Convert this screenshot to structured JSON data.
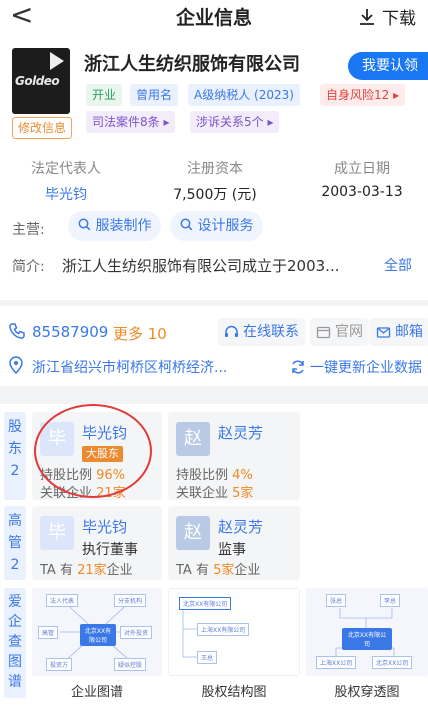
{
  "header": {
    "back_glyph": "<",
    "title": "企业信息",
    "download_label": "下载"
  },
  "company": {
    "logo_text": "Goldeo",
    "name": "浙江人生纺织服饰有限公司",
    "claim_label": "我要认领",
    "tags": [
      "开业",
      "曾用名",
      "A级纳税人 (2023)",
      "自身风险12 ▸",
      "司法案件8条 ▸",
      "涉诉关系5个 ▸"
    ],
    "edit_label": "修改信息"
  },
  "stats": {
    "legal_rep_label": "法定代表人",
    "legal_rep": "毕光钧",
    "capital_label": "注册资本",
    "capital": "7,500万 (元)",
    "founded_label": "成立日期",
    "founded": "2003-03-13"
  },
  "business": {
    "label": "主营:",
    "chips": [
      "服装制作",
      "设计服务"
    ]
  },
  "intro": {
    "label": "简介:",
    "text": "浙江人生纺织服饰有限公司成立于2003...",
    "all_label": "全部"
  },
  "contact": {
    "phone": "85587909",
    "more": "更多 10",
    "actions": [
      "在线联系",
      "官网",
      "邮箱"
    ],
    "address": "浙江省绍兴市柯桥区柯桥经济...",
    "update_label": "一键更新企业数据"
  },
  "shareholders": {
    "side_label": [
      "股",
      "东",
      "2"
    ],
    "items": [
      {
        "avatar": "毕",
        "name": "毕光钧",
        "badge": "大股东",
        "ratio_label": "持股比例",
        "ratio": "96%",
        "rel_label": "关联企业",
        "rel": "21家"
      },
      {
        "avatar": "赵",
        "name": "赵灵芳",
        "ratio_label": "持股比例",
        "ratio": "4%",
        "rel_label": "关联企业",
        "rel": "5家"
      }
    ]
  },
  "executives": {
    "side_label": [
      "高",
      "管",
      "2"
    ],
    "items": [
      {
        "avatar": "毕",
        "name": "毕光钧",
        "role": "执行董事",
        "pre": "TA 有",
        "count": "21家",
        "post": "企业"
      },
      {
        "avatar": "赵",
        "name": "赵灵芳",
        "role": "监事",
        "pre": "TA 有",
        "count": "5家",
        "post": "企业"
      }
    ]
  },
  "graphs": {
    "side_label": [
      "爱",
      "企",
      "查",
      "图",
      "谱"
    ],
    "items": [
      "企业图谱",
      "股权结构图",
      "股权穿透图"
    ],
    "thumb1": {
      "hub": "北京XX有限公司",
      "nodes": [
        "法人代表",
        "分支机构",
        "高管",
        "对外投资",
        "投资方",
        "疑似控股"
      ]
    },
    "thumb2": {
      "top": "北京XX有限公司",
      "rows": [
        "上海XX有限公司",
        "王总"
      ]
    },
    "thumb3": {
      "top": [
        "张总",
        "李总"
      ],
      "hub": "北京XX有限公司",
      "bottom": [
        "上海XX公司",
        "北京XX公司"
      ]
    }
  },
  "colors": {
    "accent": "#3b78e7",
    "orange": "#f08a24",
    "red_circle": "#e03a3a"
  }
}
